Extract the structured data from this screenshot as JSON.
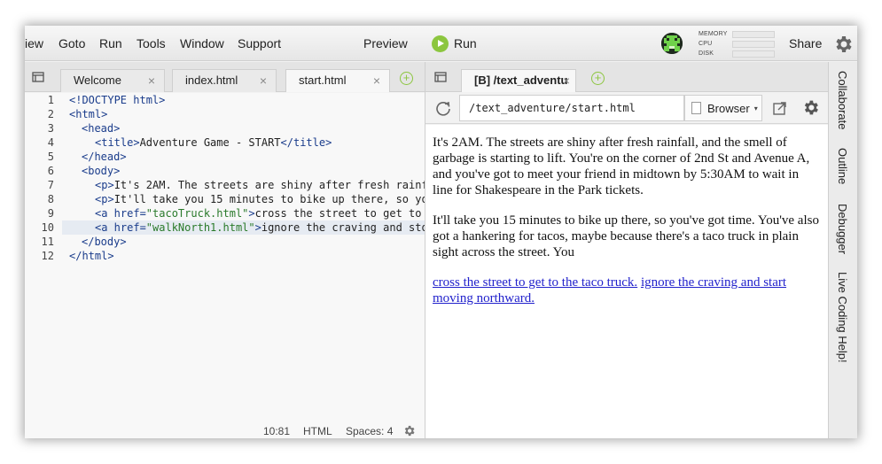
{
  "menu": {
    "items": [
      "iew",
      "Goto",
      "Run",
      "Tools",
      "Window",
      "Support"
    ],
    "preview": "Preview",
    "run": "Run",
    "share": "Share"
  },
  "stats": {
    "memory": "MEMORY",
    "cpu": "CPU",
    "disk": "DISK"
  },
  "editor": {
    "tabs": [
      "Welcome",
      "index.html",
      "start.html"
    ],
    "active_tab": 2,
    "close_glyph": "×",
    "add_glyph": "+",
    "line_numbers": [
      "1",
      "2",
      "3",
      "4",
      "5",
      "6",
      "7",
      "8",
      "9",
      "10",
      "11",
      "12"
    ],
    "current_line": 10,
    "code": {
      "l1": "<!DOCTYPE html>",
      "l2": "<html>",
      "l3": "<head>",
      "l4_open": "<title>",
      "l4_text": "Adventure Game - START",
      "l4_close": "</title>",
      "l5": "</head>",
      "l6": "<body>",
      "l7_tag": "<p>",
      "l7_text": "It's 2AM. The streets are shiny after fresh rainf",
      "l8_tag": "<p>",
      "l8_text": "It'll take you 15 minutes to bike up there, so yo",
      "l9_tag": "<a href=",
      "l9_str": "\"tacoTruck.html\"",
      "l9_tag2": ">",
      "l9_text": "cross the street to get to",
      "l10_tag": "<a href=",
      "l10_str": "\"walkNorth1.html\"",
      "l10_tag2": ">",
      "l10_text": "ignore the craving and sto",
      "l11": "</body>",
      "l12": "</html>"
    },
    "status": {
      "position": "10:81",
      "language": "HTML",
      "spaces": "Spaces: 4"
    }
  },
  "preview": {
    "tab": "[B] /text_adventu",
    "url": "/text_adventure/start.html",
    "browser": "Browser",
    "paragraph1": "It's 2AM. The streets are shiny after fresh rainfall, and the smell of garbage is starting to lift. You're on the corner of 2nd St and Avenue A, and you've got to meet your friend in midtown by 5:30AM to wait in line for Shakespeare in the Park tickets.",
    "paragraph2": "It'll take you 15 minutes to bike up there, so you've got time. You've also got a hankering for tacos, maybe because there's a taco truck in plain sight across the street. You",
    "link1": "cross the street to get to the taco truck.",
    "link2": "ignore the craving and start moving northward."
  },
  "sidebar": [
    "Collaborate",
    "Outline",
    "Debugger",
    "Live Coding Help!"
  ],
  "colors": {
    "accent_green": "#8cc63f",
    "link": "#2222cc",
    "tag": "#1a3c8b",
    "string": "#2a7a2a"
  }
}
